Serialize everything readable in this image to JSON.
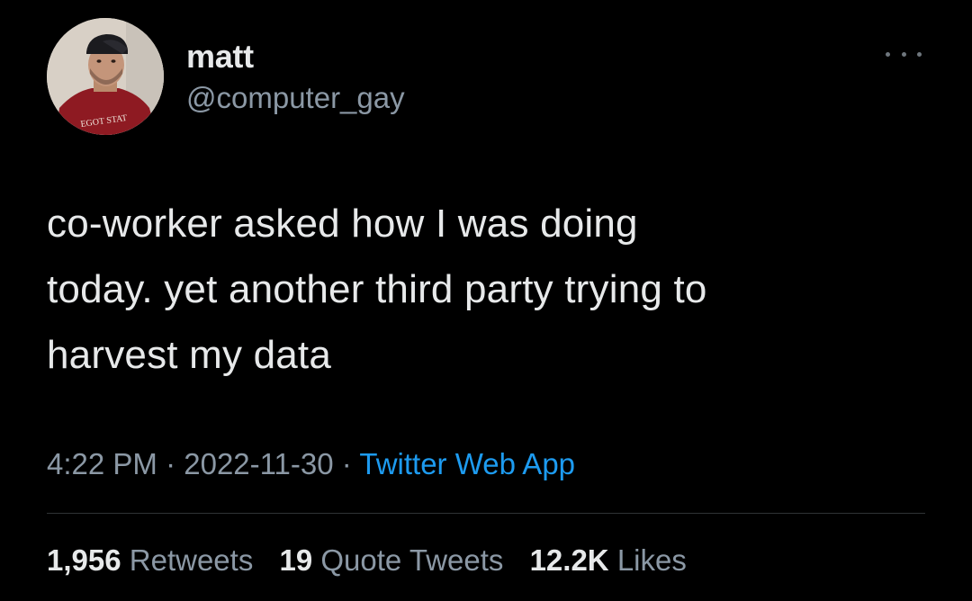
{
  "author": {
    "display_name": "matt",
    "handle": "@computer_gay",
    "avatar_shirt_text": "EGOT STAT"
  },
  "tweet": {
    "text": "co-worker asked how I was doing\ntoday. yet another third party trying to\nharvest my data",
    "time": "4:22 PM",
    "date": "2022-11-30",
    "separator": "·",
    "source": "Twitter Web App"
  },
  "stats": {
    "retweets_count": "1,956",
    "retweets_label": "Retweets",
    "quotes_count": "19",
    "quotes_label": "Quote Tweets",
    "likes_count": "12.2K",
    "likes_label": "Likes"
  },
  "colors": {
    "background": "#000000",
    "text_primary": "#e7e9ea",
    "text_secondary": "#8b98a5",
    "link_blue": "#1d9bf0",
    "divider": "#2f3336"
  }
}
